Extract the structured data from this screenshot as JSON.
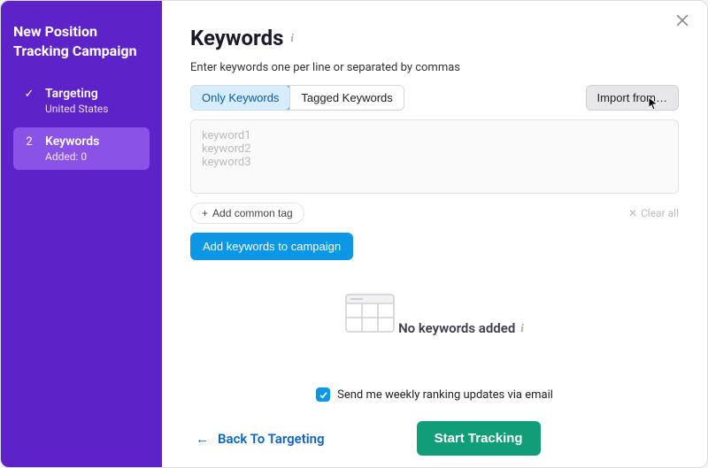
{
  "sidebar": {
    "title": "New Position Tracking Campaign",
    "steps": [
      {
        "indicator": "✓",
        "title": "Targeting",
        "sub": "United States"
      },
      {
        "indicator": "2",
        "title": "Keywords",
        "sub": "Added: 0"
      }
    ]
  },
  "header": {
    "title": "Keywords",
    "subtext": "Enter keywords one per line or separated by commas"
  },
  "tabs": {
    "only": "Only Keywords",
    "tagged": "Tagged Keywords"
  },
  "import_button": "Import from…",
  "textarea_placeholder": "keyword1\nkeyword2\nkeyword3",
  "add_tag_label": "Add common tag",
  "clear_all_label": "Clear all",
  "add_keywords_button": "Add keywords to campaign",
  "empty_state_title": "No keywords added",
  "email_checkbox_label": "Send me weekly ranking updates via email",
  "email_checked": true,
  "back_label": "Back To Targeting",
  "start_button": "Start Tracking"
}
